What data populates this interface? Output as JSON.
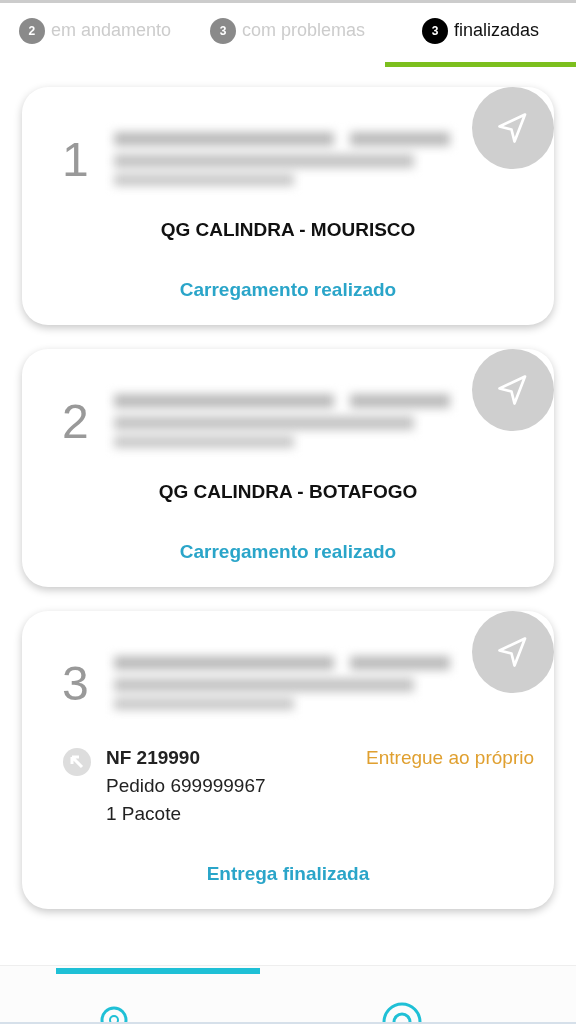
{
  "tabs": [
    {
      "count": "2",
      "label": "em andamento",
      "selected": false
    },
    {
      "count": "3",
      "label": "com problemas",
      "selected": false
    },
    {
      "count": "3",
      "label": "finalizadas",
      "selected": true
    }
  ],
  "stops": [
    {
      "number": "1",
      "place": "QG CALINDRA - MOURISCO",
      "status": "Carregamento realizado"
    },
    {
      "number": "2",
      "place": "QG CALINDRA - BOTAFOGO",
      "status": "Carregamento realizado"
    },
    {
      "number": "3",
      "invoice": "NF 219990",
      "order": "Pedido 699999967",
      "packages": "1 Pacote",
      "delivery_note": "Entregue ao próprio",
      "status": "Entrega finalizada"
    }
  ],
  "bottom_nav": [
    {
      "selected": true
    },
    {
      "selected": false
    }
  ]
}
